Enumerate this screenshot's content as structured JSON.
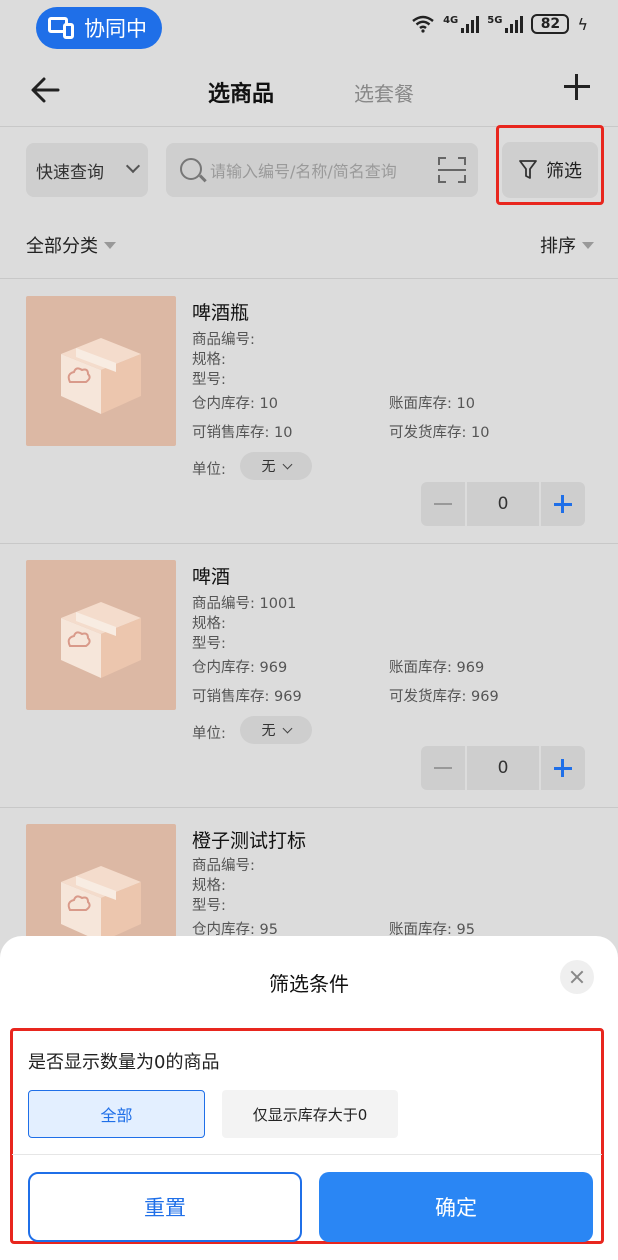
{
  "status_bar": {
    "sync_label": "协同中",
    "net1": "4G",
    "net2": "5G",
    "battery": "82"
  },
  "nav": {
    "tab_active": "选商品",
    "tab_other": "选套餐"
  },
  "toolbar": {
    "quick_query": "快速查询",
    "search_placeholder": "请输入编号/名称/简名查询",
    "filter_label": "筛选"
  },
  "category": {
    "all_label": "全部分类",
    "sort_label": "排序"
  },
  "labels": {
    "code": "商品编号:",
    "spec": "规格:",
    "model": "型号:",
    "warehouse_stock": "仓内库存:",
    "book_stock": "账面库存:",
    "sellable_stock": "可销售库存:",
    "shippable_stock": "可发货库存:",
    "unit": "单位:"
  },
  "products": [
    {
      "name": "啤酒瓶",
      "code": "",
      "warehouse_stock": "10",
      "book_stock": "10",
      "sellable_stock": "10",
      "shippable_stock": "10",
      "unit": "无",
      "qty": "0"
    },
    {
      "name": "啤酒",
      "code": "1001",
      "warehouse_stock": "969",
      "book_stock": "969",
      "sellable_stock": "969",
      "shippable_stock": "969",
      "unit": "无",
      "qty": "0"
    },
    {
      "name": "橙子测试打标",
      "code": "",
      "warehouse_stock": "95",
      "book_stock": "95"
    }
  ],
  "sheet": {
    "title": "筛选条件",
    "question": "是否显示数量为0的商品",
    "option_all": "全部",
    "option_stock": "仅显示库存大于0",
    "reset": "重置",
    "confirm": "确定"
  },
  "colors": {
    "accent": "#1f6fe8",
    "confirm_bg": "#2a86f4",
    "highlight": "#e8261e"
  }
}
